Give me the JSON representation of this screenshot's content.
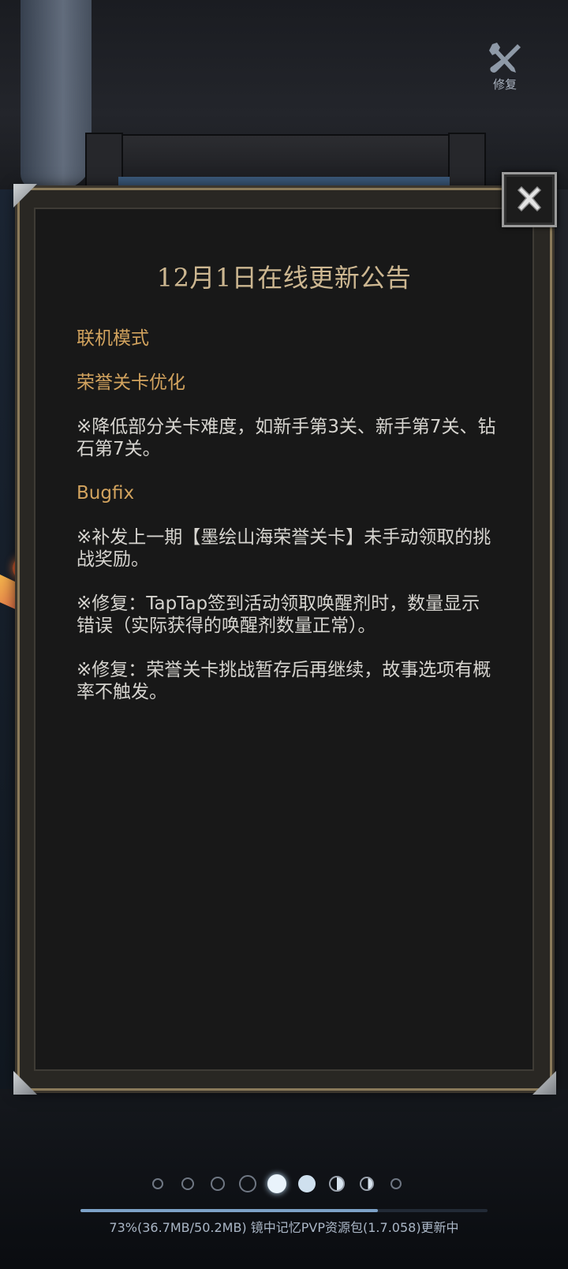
{
  "repair": {
    "icon": "wrench-screwdriver-icon",
    "label": "修复"
  },
  "announcement": {
    "title": "12月1日在线更新公告",
    "close_icon": "close-icon",
    "sections": [
      {
        "type": "heading",
        "text": "联机模式"
      },
      {
        "type": "heading",
        "text": "荣誉关卡优化"
      },
      {
        "type": "paragraph",
        "lines": [
          "※降低部分关卡难度，如新手第3关、新手第7关、钻",
          "石第7关。"
        ]
      },
      {
        "type": "heading",
        "text": "Bugfix"
      },
      {
        "type": "paragraph",
        "lines": [
          "※补发上一期【墨绘山海荣誉关卡】未手动领取的挑",
          "战奖励。"
        ]
      },
      {
        "type": "paragraph",
        "lines": [
          "※修复：TapTap签到活动领取唤醒剂时，数量显示",
          "错误（实际获得的唤醒剂数量正常）。"
        ]
      },
      {
        "type": "paragraph",
        "lines": [
          "※修复：荣誉关卡挑战暂存后再继续，故事选项有概",
          "率不触发。"
        ]
      }
    ],
    "accent_color": "#d2a35e",
    "title_color": "#cdb791"
  },
  "pagination": {
    "total": 9,
    "current": 5
  },
  "download": {
    "progress_percent": 73,
    "status_text": "73%(36.7MB/50.2MB) 镜中记忆PVP资源包(1.7.058)更新中"
  }
}
